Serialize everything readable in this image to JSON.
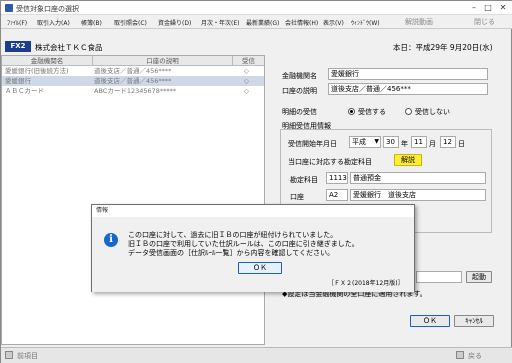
{
  "window": {
    "title": "受信対象口座の選択"
  },
  "menu": [
    "ﾌｧｲﾙ(F)",
    "取引入力(A)",
    "帳簿(B)",
    "取引照会(C)",
    "資金繰り(D)",
    "月次・年次(E)",
    "最新業績(G)",
    "会社情報(H)",
    "表示(V)",
    "ｳｨﾝﾄﾞｳ(W)"
  ],
  "toolbar": {
    "help": "解説動画",
    "close": "閉じる"
  },
  "header": {
    "badge": "FX2",
    "company": "株式会社ＴＫＣ食品",
    "date": "本日：平成29年 9月20日(水)"
  },
  "list": {
    "columns": [
      "金融機関名",
      "口座の説明",
      "受信"
    ],
    "rows": [
      {
        "bank": "愛媛銀行(旧後続方法)",
        "desc": "道後支店／普通／456****",
        "rx": "◇"
      },
      {
        "bank": "愛媛銀行",
        "desc": "道後支店／普通／456****",
        "rx": "◇"
      },
      {
        "bank": "ＡＢＣカード",
        "desc": "ABCカード12345678*****",
        "rx": "◇"
      }
    ]
  },
  "form": {
    "bank_label": "金融機関名",
    "bank_value": "愛媛銀行",
    "desc_label": "口座の説明",
    "desc_value": "道後支店／普通／456***",
    "receive_label": "明細の受信",
    "receive_yes": "受信する",
    "receive_no": "受信しない",
    "info_label": "明細受信用情報",
    "start_label": "受信開始年月日",
    "era": "平成",
    "year": "30",
    "year_unit": "年",
    "month": "11",
    "month_unit": "月",
    "day": "12",
    "day_unit": "日",
    "acct_header": "当口座に対応する勘定科目",
    "explain_btn": "解説",
    "acct_label": "勘定科目",
    "acct_code": "1113",
    "acct_name": "普通預金",
    "koza_label": "口座",
    "koza_code": "A2",
    "koza_name": "愛媛銀行　道後支店",
    "launch_btn": "起動",
    "note": "◆設定は当金融機関の全口座に適用されます。",
    "ok_btn": "ＯＫ",
    "cancel_btn": "ｷｬﾝｾﾙ"
  },
  "status": {
    "prev": "前項目",
    "back": "戻る"
  },
  "dialog": {
    "title": "情報",
    "lines": [
      "この口座に対して、過去に旧ＩＢの口座が紐付けられていました。",
      "旧ＩＢの口座で利用していた仕訳ルールは、この口座に引き継ぎました。",
      "データ受信画面の［仕訳ﾙｰﾙ一覧］から内容を確認してください。"
    ],
    "ok": "ＯＫ",
    "version": "［ＦＸ２(2018年12月版)］"
  }
}
